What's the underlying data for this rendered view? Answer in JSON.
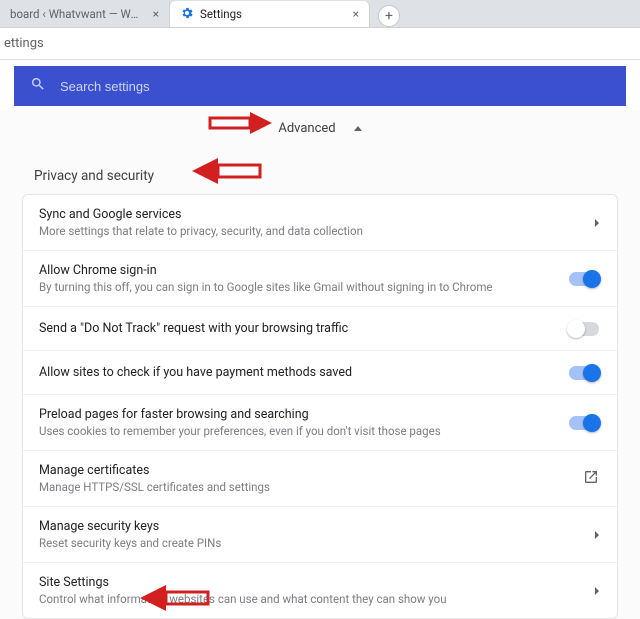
{
  "tabs": {
    "inactive_title": "board ‹ Whatvwant — Word",
    "active_title": "Settings"
  },
  "header_text": "ettings",
  "search": {
    "placeholder": "Search settings"
  },
  "advanced_label": "Advanced",
  "section_title": "Privacy and security",
  "rows": [
    {
      "title": "Sync and Google services",
      "sub": "More settings that relate to privacy, security, and data collection"
    },
    {
      "title": "Allow Chrome sign-in",
      "sub": "By turning this off, you can sign in to Google sites like Gmail without signing in to Chrome"
    },
    {
      "title": "Send a \"Do Not Track\" request with your browsing traffic",
      "sub": ""
    },
    {
      "title": "Allow sites to check if you have payment methods saved",
      "sub": ""
    },
    {
      "title": "Preload pages for faster browsing and searching",
      "sub": "Uses cookies to remember your preferences, even if you don't visit those pages"
    },
    {
      "title": "Manage certificates",
      "sub": "Manage HTTPS/SSL certificates and settings"
    },
    {
      "title": "Manage security keys",
      "sub": "Reset security keys and create PINs"
    },
    {
      "title": "Site Settings",
      "sub": "Control what information websites can use and what content they can show you"
    }
  ]
}
